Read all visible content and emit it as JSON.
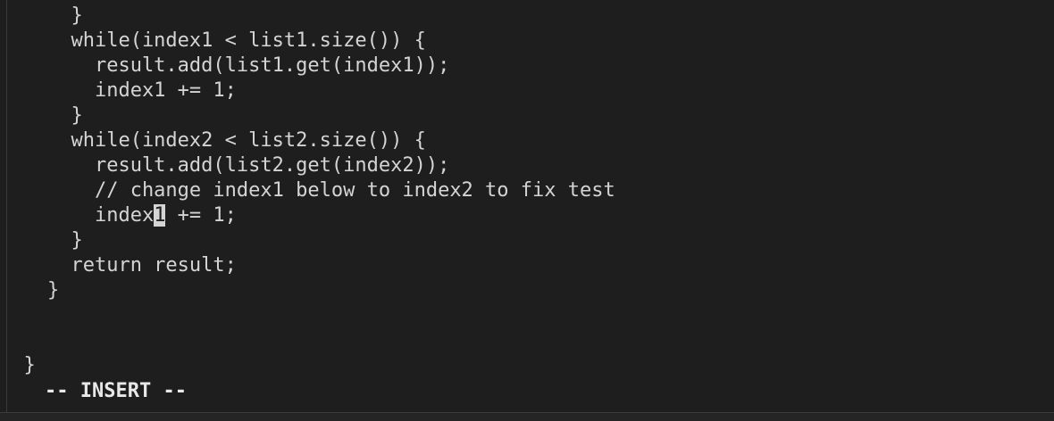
{
  "editor": {
    "top_partial": "      }",
    "lines": [
      "      }",
      "      while(index1 < list1.size()) {",
      "        result.add(list1.get(index1));",
      "        index1 += 1;",
      "      }",
      "      while(index2 < list2.size()) {",
      "        result.add(list2.get(index2));",
      "        // change index1 below to index2 to fix test",
      "",
      "      }",
      "      return result;",
      "    }",
      "",
      "",
      "  }"
    ],
    "cursor_line": {
      "before": "        index",
      "cursor_char": "1",
      "after": " += 1;"
    }
  },
  "status": {
    "mode": "-- INSERT --"
  },
  "colors": {
    "background": "#1e1e1e",
    "foreground": "#d4d4d4",
    "cursor": "#d4d4d4"
  }
}
